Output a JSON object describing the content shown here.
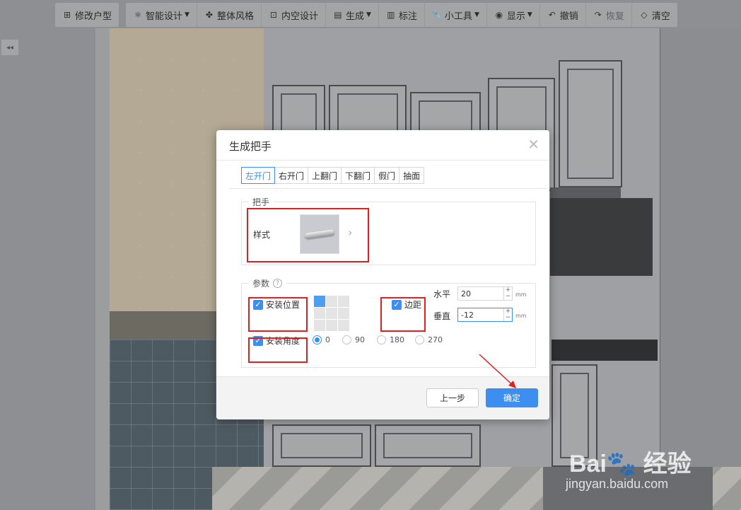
{
  "toolbar": {
    "items": [
      {
        "label": "修改户型"
      },
      {
        "label": "智能设计"
      },
      {
        "label": "整体风格"
      },
      {
        "label": "内空设计"
      },
      {
        "label": "生成"
      },
      {
        "label": "标注"
      },
      {
        "label": "小工具"
      },
      {
        "label": "显示"
      },
      {
        "label": "撤销"
      },
      {
        "label": "恢复"
      },
      {
        "label": "清空"
      }
    ]
  },
  "dialog": {
    "title": "生成把手",
    "tabs": [
      {
        "label": "左开门"
      },
      {
        "label": "右开门"
      },
      {
        "label": "上翻门"
      },
      {
        "label": "下翻门"
      },
      {
        "label": "假门"
      },
      {
        "label": "抽面"
      }
    ],
    "handle_section": {
      "legend": "把手",
      "style_label": "样式"
    },
    "params_section": {
      "legend": "参数",
      "install_position_label": "安装位置",
      "edge_distance_label": "边距",
      "horizontal_label": "水平",
      "horizontal_value": "20",
      "vertical_label": "垂直",
      "vertical_value": "-12",
      "unit": "mm",
      "install_angle_label": "安装角度",
      "angle_options": [
        "0",
        "90",
        "180",
        "270"
      ],
      "selected_angle": "0"
    },
    "buttons": {
      "prev": "上一步",
      "confirm": "确定"
    }
  },
  "watermark": {
    "brand": "Bai",
    "brand_suffix": "经验",
    "url": "jingyan.baidu.com"
  },
  "colors": {
    "accent": "#3c8ff0",
    "highlight": "#e02020"
  }
}
